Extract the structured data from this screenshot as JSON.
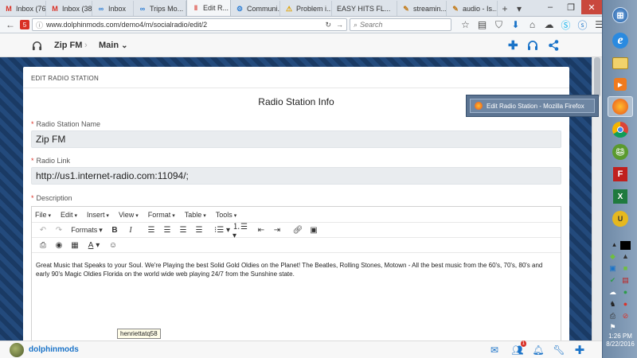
{
  "browser": {
    "tabs": [
      {
        "label": "Inbox (76...",
        "icon": "gmail-icon",
        "glyph": "M",
        "color": "#d93025"
      },
      {
        "label": "Inbox (38...",
        "icon": "gmail-icon",
        "glyph": "M",
        "color": "#d93025"
      },
      {
        "label": "Inbox",
        "icon": "infinity-icon",
        "glyph": "∞",
        "color": "#2b7cd3"
      },
      {
        "label": "Trips Mo...",
        "icon": "infinity-icon",
        "glyph": "∞",
        "color": "#2b7cd3"
      },
      {
        "label": "Edit R...",
        "icon": "pause-icon",
        "glyph": "‖",
        "color": "#d93025"
      },
      {
        "label": "Communi...",
        "icon": "gear-icon",
        "glyph": "⚙",
        "color": "#2b7cd3"
      },
      {
        "label": "Problem i...",
        "icon": "warning-icon",
        "glyph": "⚠",
        "color": "#e0a100"
      },
      {
        "label": "EASY HITS FL...",
        "icon": "",
        "glyph": "",
        "color": "#333"
      },
      {
        "label": "streamin...",
        "icon": "feather-icon",
        "glyph": "✎",
        "color": "#c27b1a"
      },
      {
        "label": "audio - Is...",
        "icon": "feather-icon",
        "glyph": "✎",
        "color": "#c27b1a"
      }
    ],
    "url": "www.dolphinmods.com/demo4/m/socialradio/edit/2",
    "search_placeholder": "Search"
  },
  "app_header": {
    "station": "Zip FM",
    "menu": "Main"
  },
  "page": {
    "section_heading": "EDIT RADIO STATION",
    "form_title": "Radio Station Info",
    "name_label": "Radio Station Name",
    "name_value": "Zip FM",
    "link_label": "Radio Link",
    "link_value": "http://us1.internet-radio.com:11094/;",
    "description_label": "Description"
  },
  "editor": {
    "menus": [
      "File",
      "Edit",
      "Insert",
      "View",
      "Format",
      "Table",
      "Tools"
    ],
    "formats_label": "Formats",
    "content": "Great Music that Speaks to your Soul. We're Playing the best Solid Gold Oldies on the Planet!   The Beatles, Rolling Stones, Motown - All the best music from the 60's, 70's, 80's and early 90's Magic Oldies Florida on the world wide web playing 24/7 from the Sunshine state."
  },
  "tooltip": "henriettatq58",
  "bottom_bar": {
    "username": "dolphinmods",
    "notification_count": "1"
  },
  "popup": {
    "label": "Edit Radio Station - Mozilla Firefox"
  },
  "taskbar": {
    "time": "1:26 PM",
    "date": "8/22/2016"
  },
  "colors": {
    "accent": "#1a73c8",
    "required": "#d9342b",
    "page_background": "#1d3f6e"
  }
}
